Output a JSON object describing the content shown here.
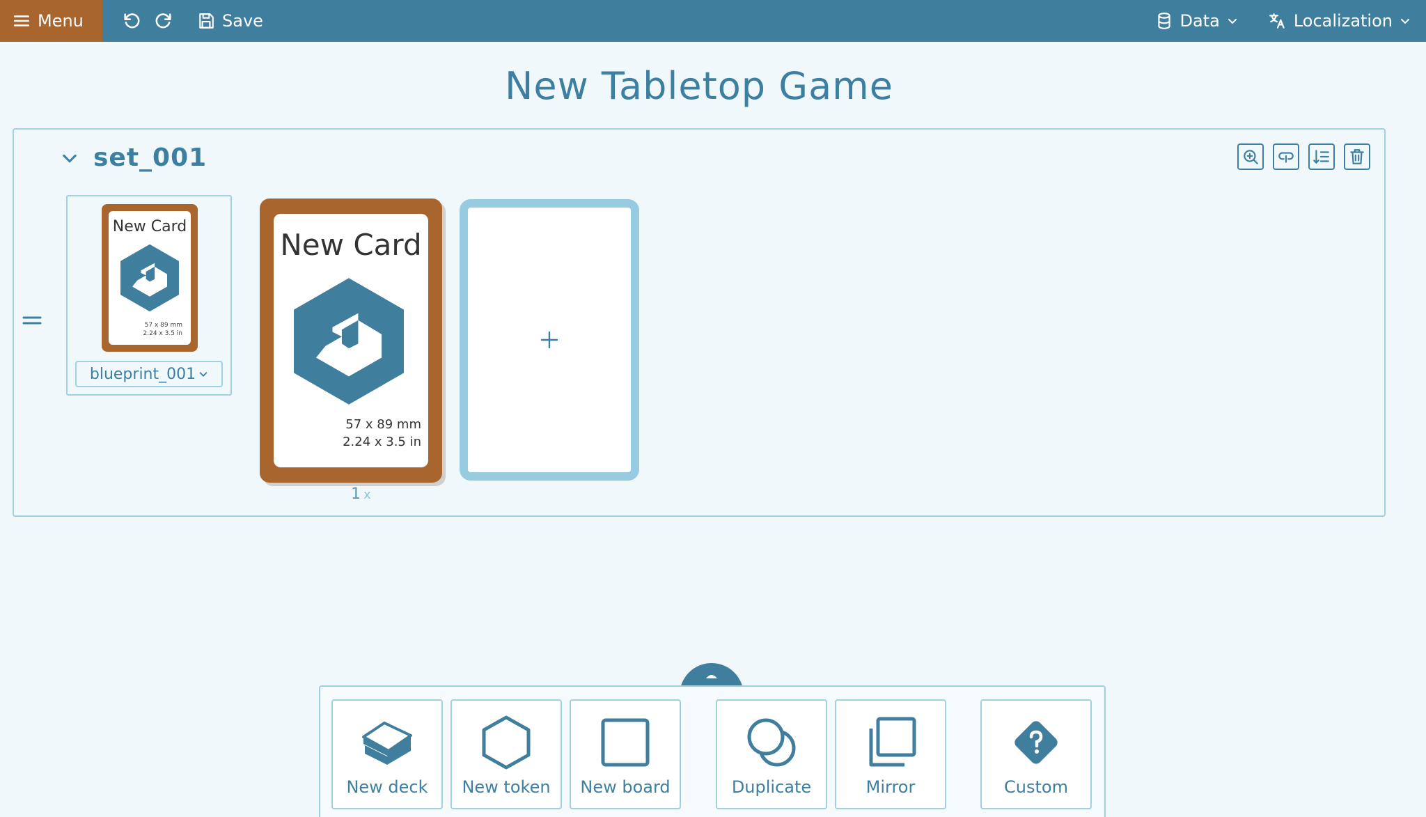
{
  "topbar": {
    "menu_label": "Menu",
    "save_label": "Save",
    "data_label": "Data",
    "localization_label": "Localization"
  },
  "page": {
    "title": "New Tabletop Game"
  },
  "set": {
    "name": "set_001",
    "blueprint": {
      "card_title": "New Card",
      "size_mm": "57 x 89 mm",
      "size_in": "2.24 x 3.5 in",
      "selected": "blueprint_001"
    },
    "card": {
      "title": "New Card",
      "size_mm": "57 x 89 mm",
      "size_in": "2.24 x 3.5 in",
      "count": "1",
      "count_suffix": "x"
    }
  },
  "toolbar": {
    "tools": [
      {
        "label": "New deck",
        "icon": "deck-icon"
      },
      {
        "label": "New token",
        "icon": "hexagon-icon"
      },
      {
        "label": "New board",
        "icon": "square-icon"
      },
      {
        "label": "Duplicate",
        "icon": "duplicate-icon"
      },
      {
        "label": "Mirror",
        "icon": "mirror-icon"
      },
      {
        "label": "Custom",
        "icon": "question-diamond-icon"
      }
    ]
  },
  "colors": {
    "topbar": "#3f7e9c",
    "menu": "#a8652e",
    "card_frame": "#a8652e",
    "accent": "#3d7fa0",
    "border": "#9fd0e3",
    "background": "#f0f8fb"
  }
}
